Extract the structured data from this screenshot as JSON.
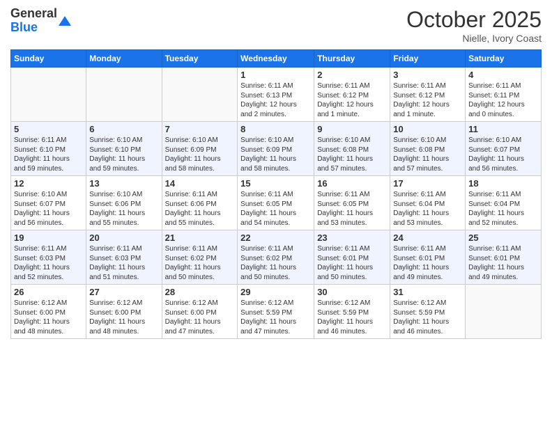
{
  "header": {
    "logo_general": "General",
    "logo_blue": "Blue",
    "month": "October 2025",
    "location": "Nielle, Ivory Coast"
  },
  "weekdays": [
    "Sunday",
    "Monday",
    "Tuesday",
    "Wednesday",
    "Thursday",
    "Friday",
    "Saturday"
  ],
  "weeks": [
    [
      {
        "day": "",
        "info": ""
      },
      {
        "day": "",
        "info": ""
      },
      {
        "day": "",
        "info": ""
      },
      {
        "day": "1",
        "info": "Sunrise: 6:11 AM\nSunset: 6:13 PM\nDaylight: 12 hours\nand 2 minutes."
      },
      {
        "day": "2",
        "info": "Sunrise: 6:11 AM\nSunset: 6:12 PM\nDaylight: 12 hours\nand 1 minute."
      },
      {
        "day": "3",
        "info": "Sunrise: 6:11 AM\nSunset: 6:12 PM\nDaylight: 12 hours\nand 1 minute."
      },
      {
        "day": "4",
        "info": "Sunrise: 6:11 AM\nSunset: 6:11 PM\nDaylight: 12 hours\nand 0 minutes."
      }
    ],
    [
      {
        "day": "5",
        "info": "Sunrise: 6:11 AM\nSunset: 6:10 PM\nDaylight: 11 hours\nand 59 minutes."
      },
      {
        "day": "6",
        "info": "Sunrise: 6:10 AM\nSunset: 6:10 PM\nDaylight: 11 hours\nand 59 minutes."
      },
      {
        "day": "7",
        "info": "Sunrise: 6:10 AM\nSunset: 6:09 PM\nDaylight: 11 hours\nand 58 minutes."
      },
      {
        "day": "8",
        "info": "Sunrise: 6:10 AM\nSunset: 6:09 PM\nDaylight: 11 hours\nand 58 minutes."
      },
      {
        "day": "9",
        "info": "Sunrise: 6:10 AM\nSunset: 6:08 PM\nDaylight: 11 hours\nand 57 minutes."
      },
      {
        "day": "10",
        "info": "Sunrise: 6:10 AM\nSunset: 6:08 PM\nDaylight: 11 hours\nand 57 minutes."
      },
      {
        "day": "11",
        "info": "Sunrise: 6:10 AM\nSunset: 6:07 PM\nDaylight: 11 hours\nand 56 minutes."
      }
    ],
    [
      {
        "day": "12",
        "info": "Sunrise: 6:10 AM\nSunset: 6:07 PM\nDaylight: 11 hours\nand 56 minutes."
      },
      {
        "day": "13",
        "info": "Sunrise: 6:10 AM\nSunset: 6:06 PM\nDaylight: 11 hours\nand 55 minutes."
      },
      {
        "day": "14",
        "info": "Sunrise: 6:11 AM\nSunset: 6:06 PM\nDaylight: 11 hours\nand 55 minutes."
      },
      {
        "day": "15",
        "info": "Sunrise: 6:11 AM\nSunset: 6:05 PM\nDaylight: 11 hours\nand 54 minutes."
      },
      {
        "day": "16",
        "info": "Sunrise: 6:11 AM\nSunset: 6:05 PM\nDaylight: 11 hours\nand 53 minutes."
      },
      {
        "day": "17",
        "info": "Sunrise: 6:11 AM\nSunset: 6:04 PM\nDaylight: 11 hours\nand 53 minutes."
      },
      {
        "day": "18",
        "info": "Sunrise: 6:11 AM\nSunset: 6:04 PM\nDaylight: 11 hours\nand 52 minutes."
      }
    ],
    [
      {
        "day": "19",
        "info": "Sunrise: 6:11 AM\nSunset: 6:03 PM\nDaylight: 11 hours\nand 52 minutes."
      },
      {
        "day": "20",
        "info": "Sunrise: 6:11 AM\nSunset: 6:03 PM\nDaylight: 11 hours\nand 51 minutes."
      },
      {
        "day": "21",
        "info": "Sunrise: 6:11 AM\nSunset: 6:02 PM\nDaylight: 11 hours\nand 50 minutes."
      },
      {
        "day": "22",
        "info": "Sunrise: 6:11 AM\nSunset: 6:02 PM\nDaylight: 11 hours\nand 50 minutes."
      },
      {
        "day": "23",
        "info": "Sunrise: 6:11 AM\nSunset: 6:01 PM\nDaylight: 11 hours\nand 50 minutes."
      },
      {
        "day": "24",
        "info": "Sunrise: 6:11 AM\nSunset: 6:01 PM\nDaylight: 11 hours\nand 49 minutes."
      },
      {
        "day": "25",
        "info": "Sunrise: 6:11 AM\nSunset: 6:01 PM\nDaylight: 11 hours\nand 49 minutes."
      }
    ],
    [
      {
        "day": "26",
        "info": "Sunrise: 6:12 AM\nSunset: 6:00 PM\nDaylight: 11 hours\nand 48 minutes."
      },
      {
        "day": "27",
        "info": "Sunrise: 6:12 AM\nSunset: 6:00 PM\nDaylight: 11 hours\nand 48 minutes."
      },
      {
        "day": "28",
        "info": "Sunrise: 6:12 AM\nSunset: 6:00 PM\nDaylight: 11 hours\nand 47 minutes."
      },
      {
        "day": "29",
        "info": "Sunrise: 6:12 AM\nSunset: 5:59 PM\nDaylight: 11 hours\nand 47 minutes."
      },
      {
        "day": "30",
        "info": "Sunrise: 6:12 AM\nSunset: 5:59 PM\nDaylight: 11 hours\nand 46 minutes."
      },
      {
        "day": "31",
        "info": "Sunrise: 6:12 AM\nSunset: 5:59 PM\nDaylight: 11 hours\nand 46 minutes."
      },
      {
        "day": "",
        "info": ""
      }
    ]
  ]
}
